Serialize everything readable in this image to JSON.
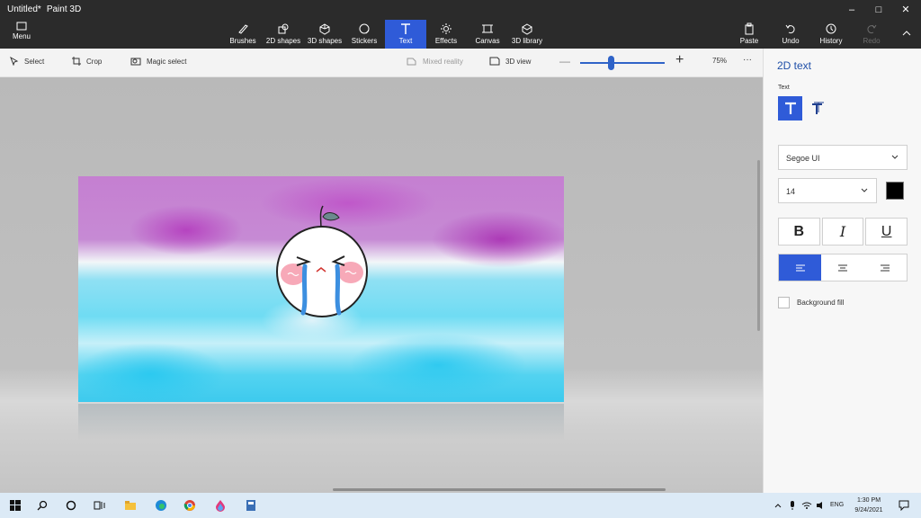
{
  "window": {
    "doc_title": "Untitled*",
    "app_name": "Paint 3D"
  },
  "ribbon": {
    "menu_label": "Menu",
    "items": [
      {
        "label": "Brushes"
      },
      {
        "label": "2D shapes"
      },
      {
        "label": "3D shapes"
      },
      {
        "label": "Stickers"
      },
      {
        "label": "Text"
      },
      {
        "label": "Effects"
      },
      {
        "label": "Canvas"
      },
      {
        "label": "3D library"
      }
    ],
    "right": [
      {
        "label": "Paste"
      },
      {
        "label": "Undo"
      },
      {
        "label": "History"
      },
      {
        "label": "Redo"
      }
    ]
  },
  "toolbar": {
    "select": "Select",
    "crop": "Crop",
    "magic_select": "Magic select",
    "mixed_reality": "Mixed reality",
    "view_3d": "3D view",
    "zoom": "75%",
    "more": "···"
  },
  "panel": {
    "title": "2D text",
    "text_label": "Text",
    "font": "Segoe UI",
    "size": "14",
    "bold": "B",
    "italic": "I",
    "underline": "U",
    "background_fill": "Background fill",
    "text_color": "#000000"
  },
  "taskbar": {
    "lang": "ENG",
    "time": "1:30 PM",
    "date": "9/24/2021"
  },
  "colors": {
    "accent": "#2f5bd8",
    "titlebar": "#2b2b2b"
  }
}
